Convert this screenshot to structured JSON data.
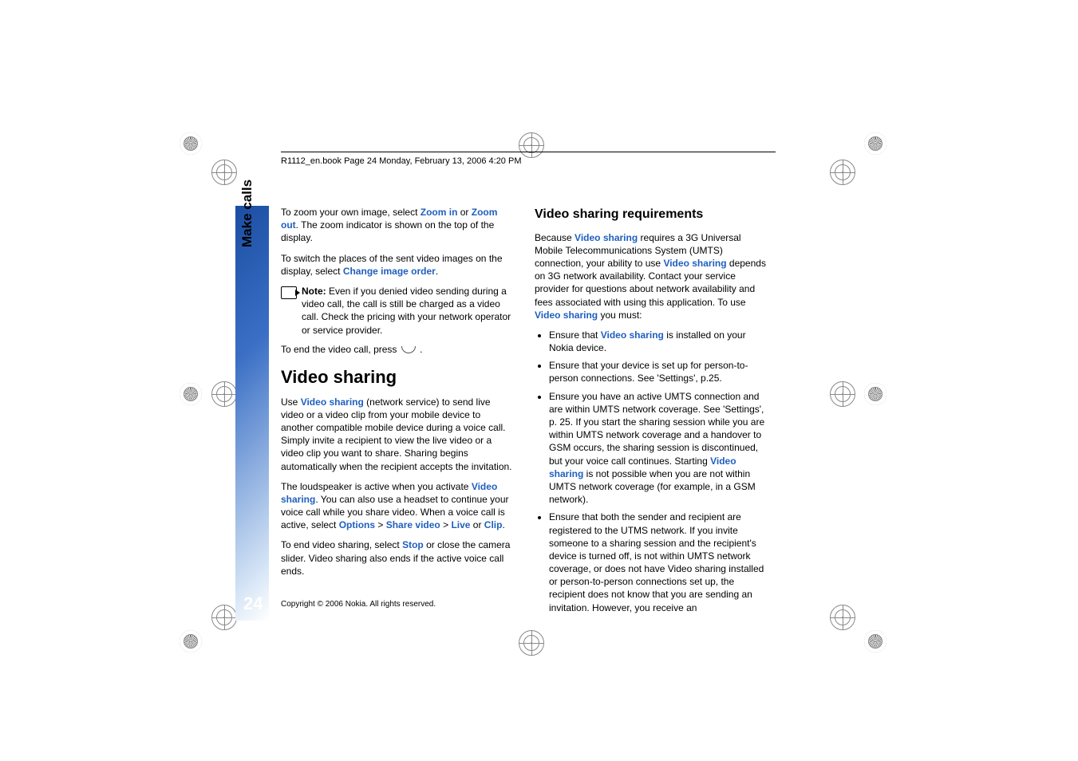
{
  "header": "R1112_en.book  Page 24  Monday, February 13, 2006  4:20 PM",
  "sidebar_label": "Make calls",
  "page_number": "24",
  "copyright": "Copyright © 2006 Nokia. All rights reserved.",
  "left": {
    "p1_a": "To zoom your own image, select ",
    "p1_zoom_in": "Zoom in",
    "p1_b": " or ",
    "p1_zoom_out": "Zoom out",
    "p1_c": ". The zoom indicator is shown on the top of the display.",
    "p2_a": "To switch the places of the sent video images on the display, select ",
    "p2_link": "Change image order",
    "p2_b": ".",
    "note_label": "Note: ",
    "note_body": "Even if you denied video sending during a video call, the call is still be charged as a video call. Check the pricing with your network operator or service provider.",
    "p3_a": "To end the video call, press ",
    "p3_b": " .",
    "h1": "Video sharing",
    "p4_a": "Use ",
    "p4_link": "Video sharing",
    "p4_b": " (network service) to send live video or a video clip from your mobile device to another compatible mobile device during a voice call. Simply invite a recipient to view the live video or a video clip you want to share. Sharing begins automatically when the recipient accepts the invitation.",
    "p5_a": "The loudspeaker is active when you activate ",
    "p5_link": "Video sharing",
    "p5_b": ". You can also use a headset to continue your voice call while you share video. When a voice call is active, select ",
    "p5_opt": "Options",
    "p5_gt1": " > ",
    "p5_share": "Share video",
    "p5_gt2": " > ",
    "p5_live": "Live",
    "p5_or": " or ",
    "p5_clip": "Clip",
    "p5_c": ".",
    "p6_a": "To end video sharing, select ",
    "p6_stop": "Stop",
    "p6_b": " or close the camera slider. Video sharing also ends if the active voice call ends."
  },
  "right": {
    "h2": "Video sharing requirements",
    "p1_a": "Because ",
    "p1_l1": "Video sharing",
    "p1_b": " requires a 3G Universal Mobile Telecommunications System (UMTS) connection, your ability to use ",
    "p1_l2": "Video sharing",
    "p1_c": " depends on 3G network availability. Contact your service provider for questions about network availability and fees associated with using this application. To use ",
    "p1_l3": "Video sharing",
    "p1_d": " you must:",
    "li1_a": "Ensure that ",
    "li1_l": "Video sharing",
    "li1_b": " is installed on your Nokia device.",
    "li2": "Ensure that your device is set up for person-to-person connections. See 'Settings', p.25.",
    "li3_a": "Ensure you have an active UMTS connection and are within UMTS network coverage. See 'Settings', p. 25. If you start the sharing session while you are within UMTS network coverage and a handover to GSM occurs, the sharing session is discontinued, but your voice call continues. Starting ",
    "li3_l": "Video sharing",
    "li3_b": " is not possible when you are not within UMTS network coverage (for example, in a GSM network).",
    "li4": "Ensure that both the sender and recipient are registered to the UTMS network. If you invite someone to a sharing session and the recipient's device is turned off, is not within UMTS network coverage, or does not have Video sharing installed or person-to-person connections set up, the recipient does not know that you are sending an invitation. However, you receive an"
  }
}
